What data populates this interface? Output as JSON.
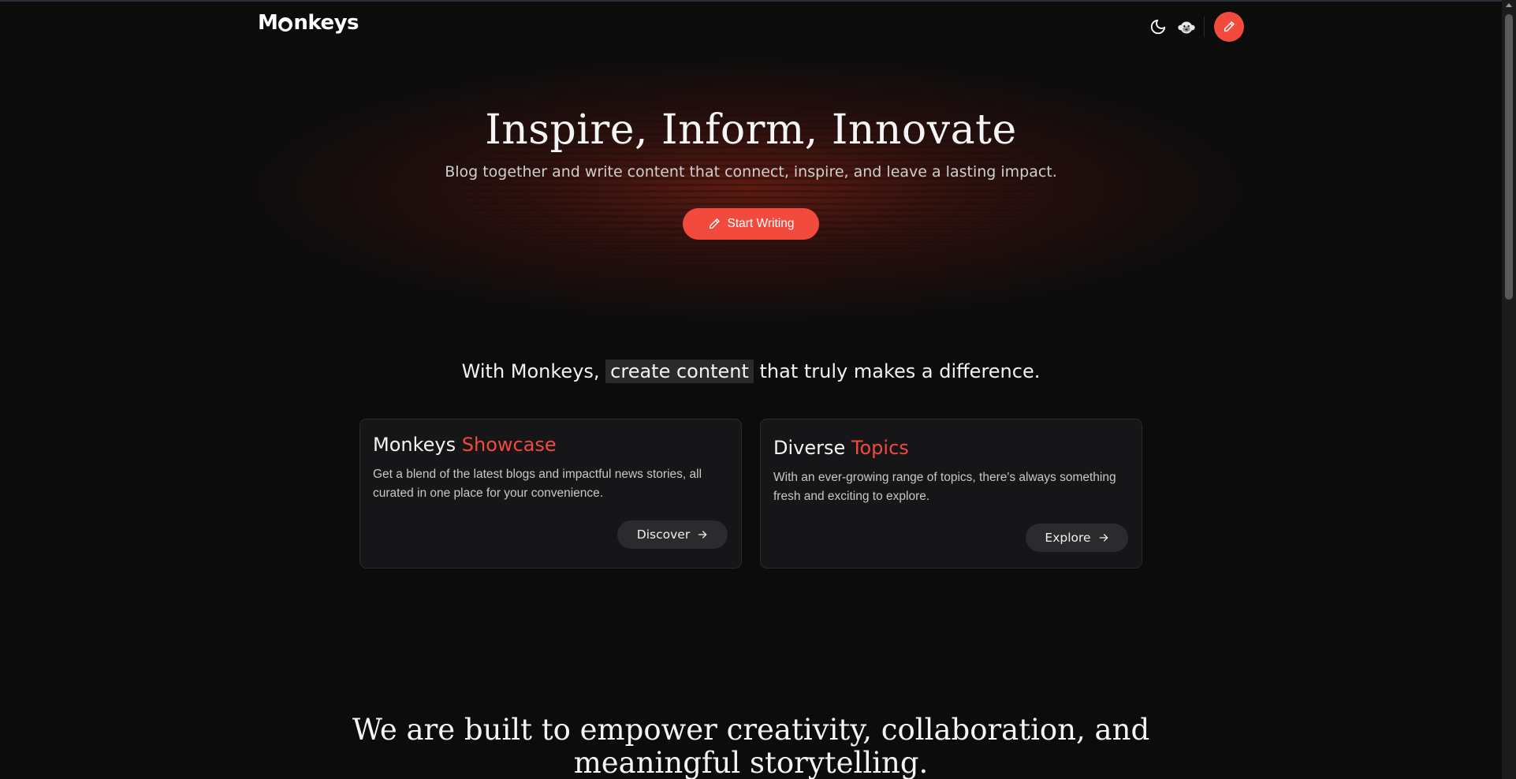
{
  "brand": {
    "logo_pre": "M",
    "logo_post": "nkeys"
  },
  "header": {
    "theme_icon": "moon-icon",
    "avatar_icon": "monkey-icon",
    "write_icon": "pencil-icon"
  },
  "hero": {
    "title": "Inspire, Inform, Innovate",
    "subtitle": "Blog together and write content that connect, inspire, and leave a lasting impact.",
    "cta_label": "Start Writing"
  },
  "tagline": {
    "before": "With Monkeys,",
    "highlight": "create content",
    "after": "that truly makes a difference."
  },
  "cards": [
    {
      "title_plain": "Monkeys",
      "title_accent": "Showcase",
      "description": "Get a blend of the latest blogs and impactful news stories, all curated in one place for your convenience.",
      "button_label": "Discover"
    },
    {
      "title_plain": "Diverse",
      "title_accent": "Topics",
      "description": "With an ever-growing range of topics, there's always something fresh and exciting to explore.",
      "button_label": "Explore"
    }
  ],
  "mission": {
    "line1": "We are built to empower creativity, collaboration, and",
    "line2": "meaningful storytelling."
  },
  "colors": {
    "accent": "#f24a3d",
    "background": "#0c0c0d",
    "card_bg": "#161618"
  }
}
